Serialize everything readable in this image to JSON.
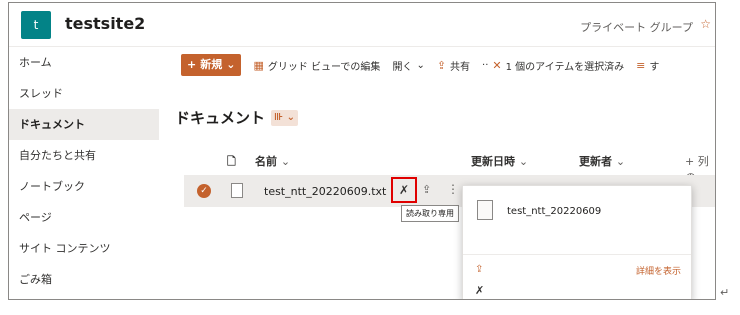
{
  "header": {
    "logo_letter": "t",
    "site_title": "testsite2",
    "group_label": "プライベート グループ",
    "star": "☆"
  },
  "nav": {
    "items": [
      "ホーム",
      "スレッド",
      "ドキュメント",
      "自分たちと共有",
      "ノートブック",
      "ページ",
      "サイト コンテンツ",
      "ごみ箱"
    ],
    "selected_index": 2
  },
  "toolbar": {
    "new_label": "新規",
    "grid_label": "グリッド ビューでの編集",
    "open_label": "開く",
    "share_label": "共有",
    "selection_label": "1 個のアイテムを選択済み",
    "overflow_label": "す"
  },
  "main": {
    "title": "ドキュメント"
  },
  "columns": {
    "name": "名前",
    "modified": "更新日時",
    "modified_by": "更新者",
    "add_column": "列の"
  },
  "row": {
    "file_name": "test_ntt_20220609.txt"
  },
  "tooltip": "読み取り専用",
  "card": {
    "file_name": "test_ntt_20220609",
    "details_label": "詳細を表示"
  },
  "colors": {
    "accent": "#c4622d",
    "site_logo": "#038387",
    "highlight_box": "#e00000"
  }
}
